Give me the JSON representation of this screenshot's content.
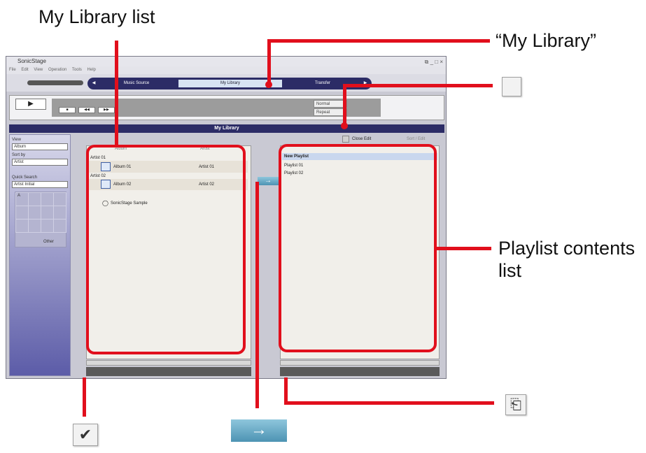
{
  "callouts": {
    "my_library_list": "My Library list",
    "my_library_tab": "“My Library”",
    "playlist_contents": "Playlist contents\nlist"
  },
  "window": {
    "title": "SonicStage",
    "controls": "⧉ _ □ ×",
    "menu": [
      "File",
      "Edit",
      "View",
      "Operation",
      "Tools",
      "Help"
    ],
    "nav_tabs": [
      "Music Source",
      "My Library",
      "Transfer"
    ],
    "active_tab": "My Library",
    "play_mode": "Normal",
    "repeat": "Repeat",
    "section_title": "My Library"
  },
  "sidebar": {
    "view_label": "View",
    "view_value": "Album",
    "sort_label": "Sort by",
    "sort_value": "Artist",
    "quick_search_label": "Quick Search",
    "quick_search_value": "Artist Initial",
    "other_label": "Other",
    "grid_letter": "A"
  },
  "library": {
    "columns": [
      "Album",
      "Artist"
    ],
    "groups": [
      "Artist 01",
      "Artist 02"
    ],
    "rows": [
      {
        "album": "Album 01",
        "artist": "Artist 01"
      },
      {
        "album": "Album 02",
        "artist": "Artist 02"
      }
    ],
    "sample": "SonicStage Sample"
  },
  "playlist": {
    "close_edit": "Close Edit",
    "sort_hint": "Sort / Edit",
    "items": [
      "New Playlist",
      "Playlist 01",
      "Playlist 02"
    ]
  },
  "icons": {
    "checkmark": "✔",
    "arrow_right": "→",
    "new_playlist": "⎗"
  },
  "colors": {
    "callout_red": "#e10f1c",
    "nav_navy": "#2c2c66",
    "arrow_blue": "#4d93b3"
  }
}
